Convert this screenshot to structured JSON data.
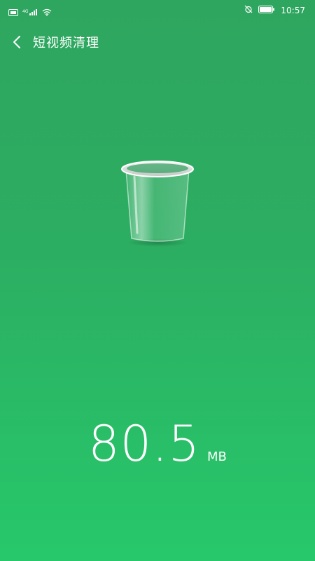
{
  "status_bar": {
    "time": "10:57",
    "icons": [
      "nfc-icon",
      "signal-icon",
      "wifi-icon",
      "alarm-off-icon",
      "battery-icon"
    ]
  },
  "header": {
    "title": "短视频清理",
    "back_icon": "chevron-left-icon"
  },
  "trash": {
    "icon": "trash-bin-icon"
  },
  "cleanup": {
    "size_value": "80.5",
    "size_unit": "MB"
  },
  "colors": {
    "background_top": "#2fa65f",
    "background_bottom": "#27c86b",
    "text": "#ffffff"
  }
}
